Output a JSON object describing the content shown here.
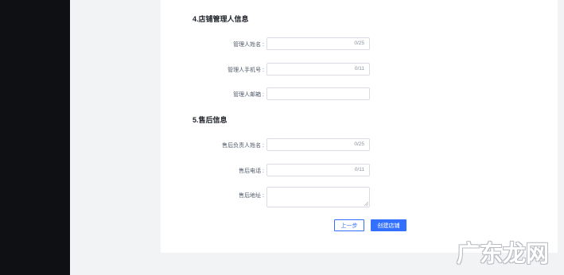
{
  "section4": {
    "title": "4.店铺管理人信息",
    "manager_name": {
      "label": "管理人姓名 :",
      "counter": "0/25"
    },
    "manager_phone": {
      "label": "管理人手机号 :",
      "counter": "0/11"
    },
    "manager_email": {
      "label": "管理人邮箱 :"
    }
  },
  "section5": {
    "title": "5.售后信息",
    "aftersale_name": {
      "label": "售后负责人姓名 :",
      "counter": "0/25"
    },
    "aftersale_phone": {
      "label": "售后电话 :",
      "counter": "0/11"
    },
    "aftersale_address": {
      "label": "售后地址 :"
    }
  },
  "buttons": {
    "prev": "上一步",
    "create": "创建店铺"
  },
  "watermark": "广东龙网",
  "colors": {
    "primary": "#3370ff",
    "sidebar": "#0f1014",
    "background": "#f2f3f5"
  }
}
